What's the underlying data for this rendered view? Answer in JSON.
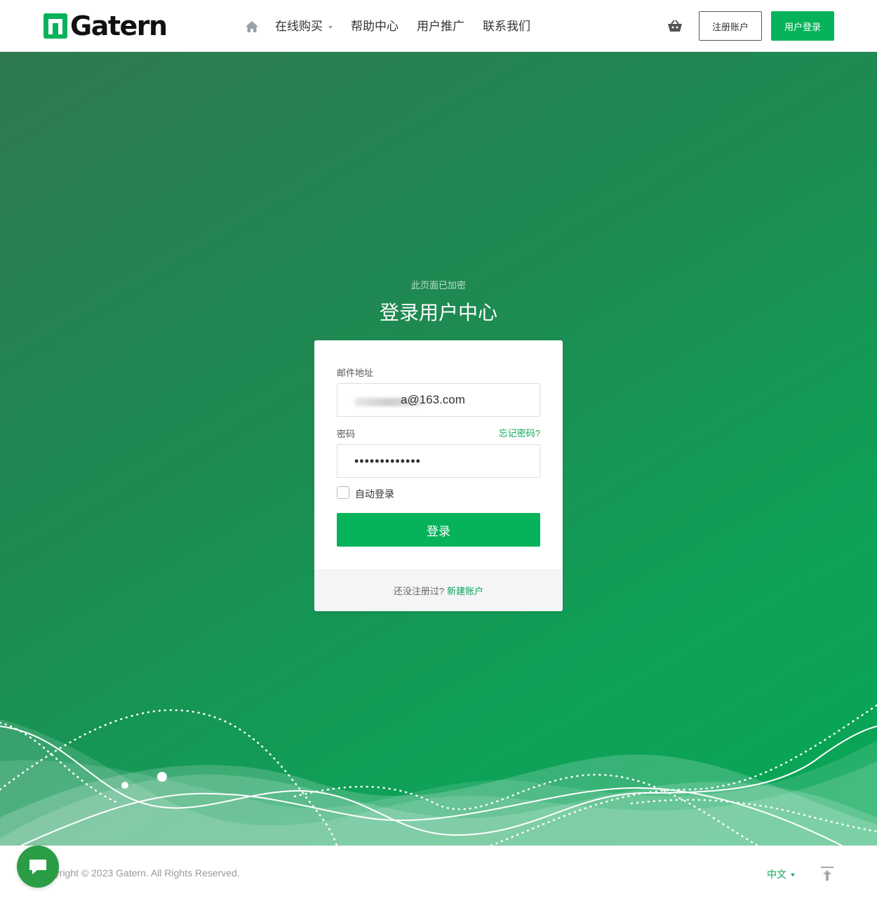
{
  "header": {
    "logo_text": "Gatern",
    "nav": [
      {
        "label": "在线购买",
        "has_dropdown": true
      },
      {
        "label": "帮助中心"
      },
      {
        "label": "用户推广"
      },
      {
        "label": "联系我们"
      }
    ],
    "register_label": "注册账户",
    "login_label": "用户登录"
  },
  "hero": {
    "subtitle": "此页面已加密",
    "title": "登录用户中心"
  },
  "form": {
    "email_label": "邮件地址",
    "email_value": "a@163.com",
    "password_label": "密码",
    "forgot_label": "忘记密码?",
    "password_mask": "•••••••••••••",
    "remember_label": "自动登录",
    "submit_label": "登录",
    "footer_text": "还没注册过?",
    "footer_link": "新建账户"
  },
  "footer": {
    "copyright": "pyright © 2023 Gatern. All Rights Reserved.",
    "language": "中文"
  },
  "colors": {
    "brand": "#07b35a",
    "hero_start": "#2e7a50",
    "hero_end": "#07a656"
  }
}
